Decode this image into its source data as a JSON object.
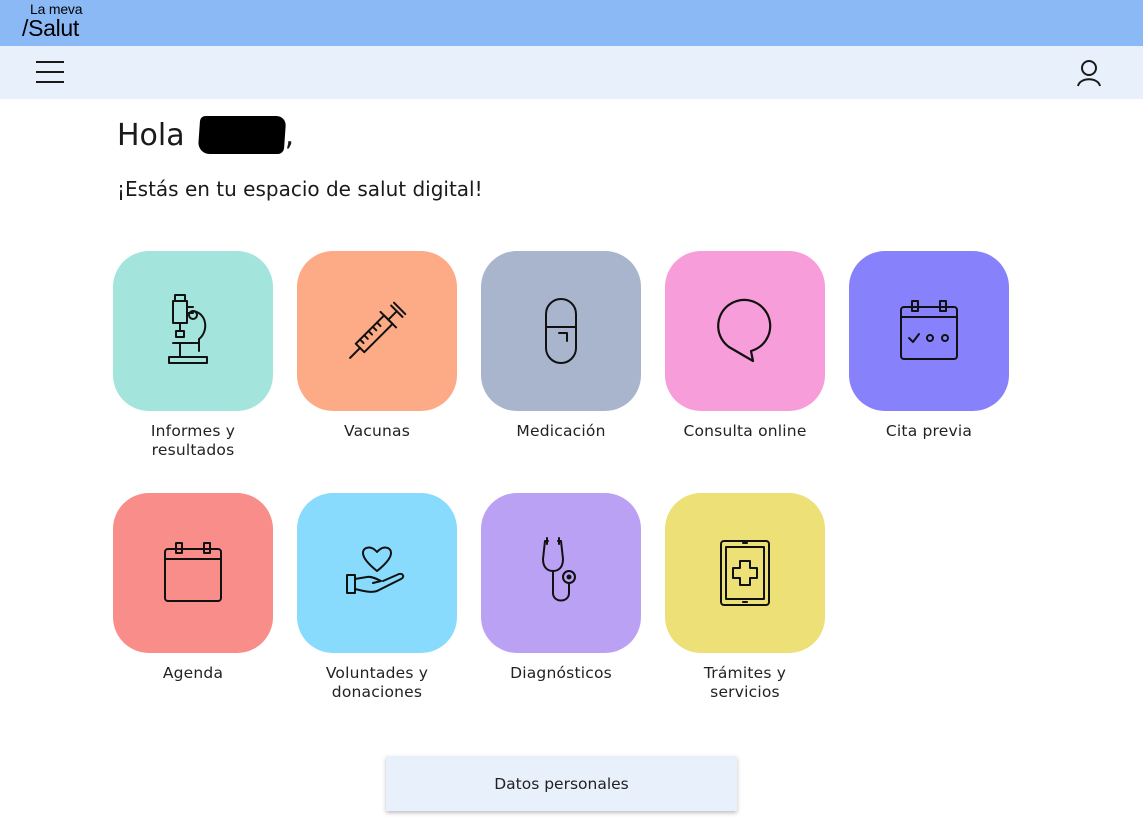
{
  "brand": {
    "line1": "La meva",
    "line2": "/Salut",
    "color": "#8bb9f5"
  },
  "nav": {
    "menu_icon": "hamburger-icon",
    "user_icon": "user-icon",
    "background": "#e8f0fc"
  },
  "greeting": {
    "hello": "Hola",
    "comma": ",",
    "subtitle": "¡Estás en tu espacio de salut digital!"
  },
  "tiles": [
    {
      "label": "Informes y\nresultados",
      "color": "#a3e4dc",
      "icon": "microscope-icon"
    },
    {
      "label": "Vacunas",
      "color": "#fdab87",
      "icon": "syringe-icon"
    },
    {
      "label": "Medicación",
      "color": "#a9b4cd",
      "icon": "pill-icon"
    },
    {
      "label": "Consulta online",
      "color": "#f79dd9",
      "icon": "chat-bubble-icon"
    },
    {
      "label": "Cita previa",
      "color": "#8782fb",
      "icon": "calendar-check-icon"
    },
    {
      "label": "Agenda",
      "color": "#f98d89",
      "icon": "calendar-icon"
    },
    {
      "label": "Voluntades y\ndonaciones",
      "color": "#88dbfc",
      "icon": "hand-heart-icon"
    },
    {
      "label": "Diagnósticos",
      "color": "#bba1f4",
      "icon": "stethoscope-icon"
    },
    {
      "label": "Trámites y\nservicios",
      "color": "#ece076",
      "icon": "tablet-medical-icon"
    }
  ],
  "footer_button": {
    "label": "Datos personales"
  }
}
